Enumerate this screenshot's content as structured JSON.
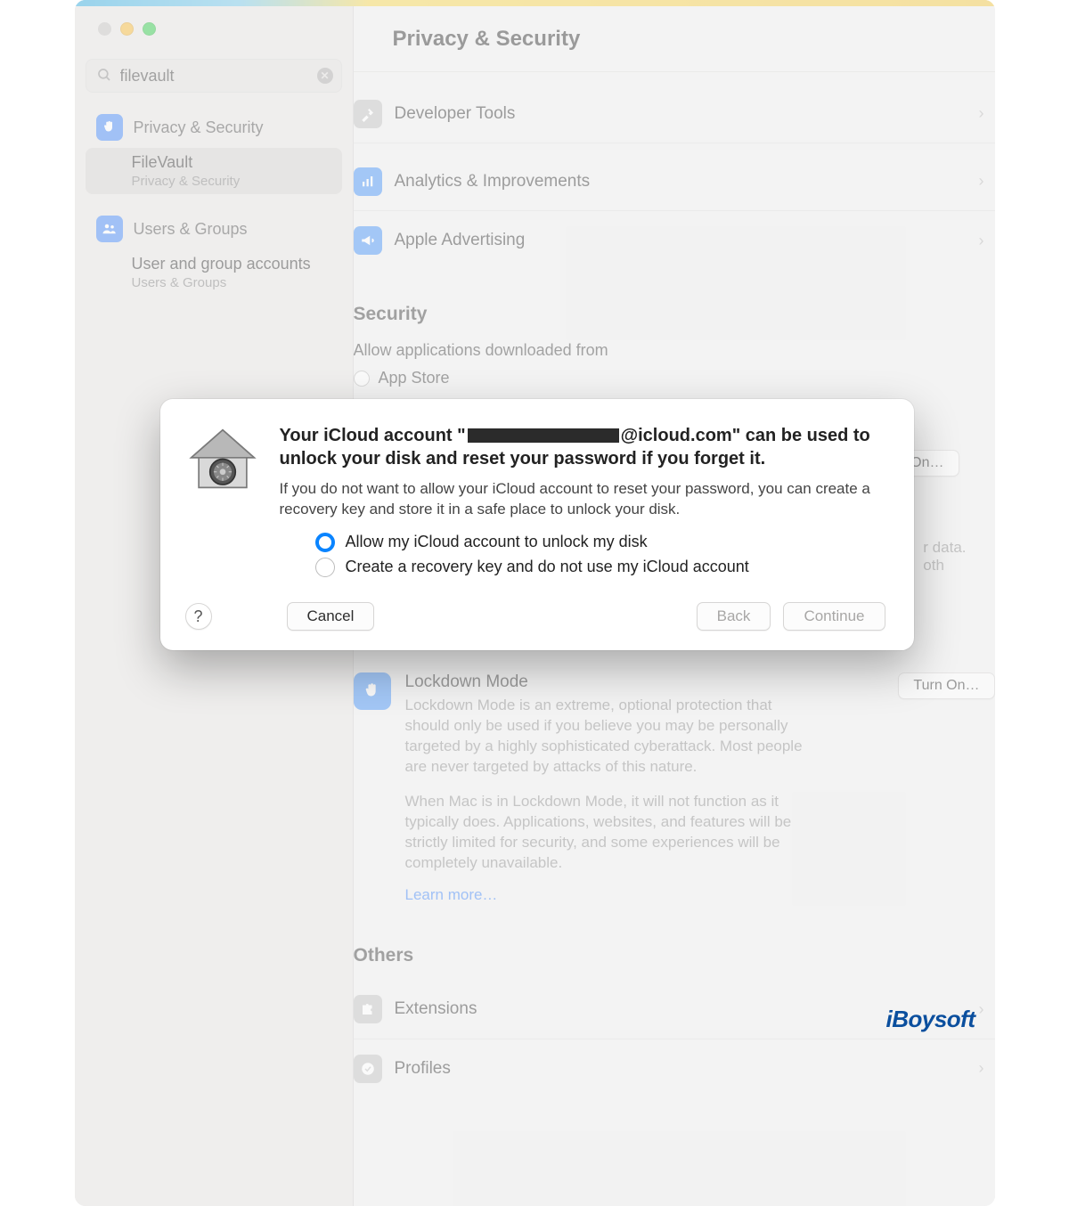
{
  "header": {
    "title": "Privacy & Security"
  },
  "search": {
    "value": "filevault"
  },
  "sidebar": {
    "privacy_label": "Privacy & Security",
    "filevault": {
      "title": "FileVault",
      "subtitle": "Privacy & Security"
    },
    "users_label": "Users & Groups",
    "users_sub": {
      "title": "User and group accounts",
      "subtitle": "Users & Groups"
    }
  },
  "rows": {
    "developer_tools": "Developer Tools",
    "analytics": "Analytics & Improvements",
    "advertising": "Apple Advertising",
    "extensions": "Extensions",
    "profiles": "Profiles"
  },
  "security": {
    "heading": "Security",
    "allow_label": "Allow applications downloaded from",
    "app_store": "App Store"
  },
  "turn_on_peek": "On…",
  "lockdown": {
    "title": "Lockdown Mode",
    "desc1": "Lockdown Mode is an extreme, optional protection that should only be used if you believe you may be personally targeted by a highly sophisticated cyberattack. Most people are never targeted by attacks of this nature.",
    "desc2": "When Mac is in Lockdown Mode, it will not function as it typically does. Applications, websites, and features will be strictly limited for security, and some experiences will be completely unavailable.",
    "learn_more": "Learn more…",
    "button": "Turn On…"
  },
  "others_heading": "Others",
  "modal": {
    "heading_prefix": "Your iCloud account \"",
    "heading_email_suffix": "@icloud.com\" can be used to unlock your disk and reset your password if you forget it.",
    "sub": "If you do not want to allow your iCloud account to reset your password, you can create a recovery key and store it in a safe place to unlock your disk.",
    "option1": "Allow my iCloud account to unlock my disk",
    "option2": "Create a recovery key and do not use my iCloud account",
    "cancel": "Cancel",
    "back": "Back",
    "continue": "Continue",
    "help": "?"
  },
  "watermark": "iBoysoft",
  "bg_text": {
    "data_tail": "r data.",
    "both_tail": "oth"
  }
}
